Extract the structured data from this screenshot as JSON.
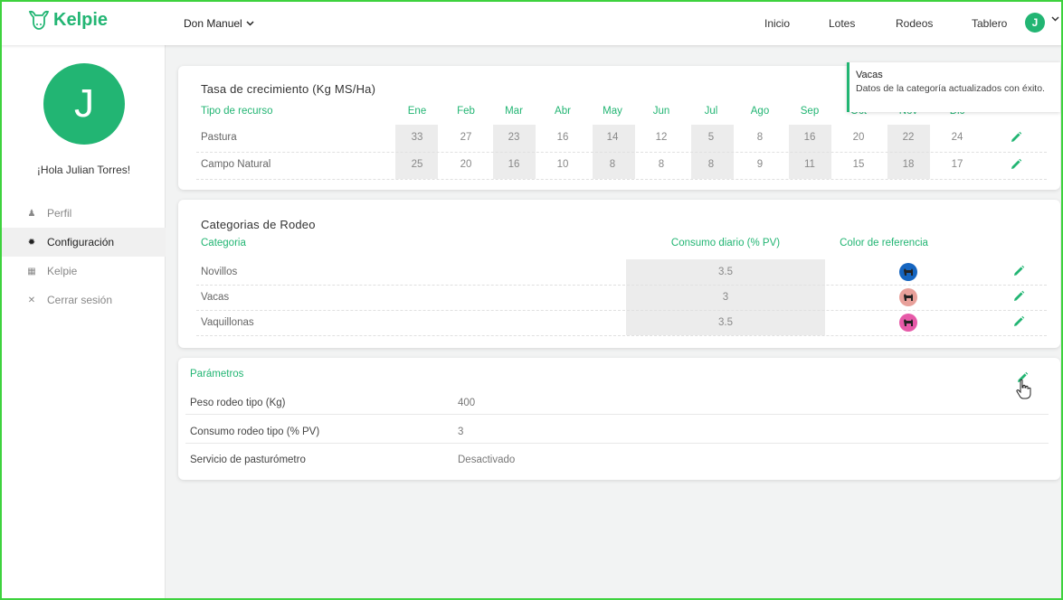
{
  "app": {
    "name": "Kelpie"
  },
  "header": {
    "farm": "Don Manuel",
    "nav": [
      "Inicio",
      "Lotes",
      "Rodeos",
      "Tablero"
    ],
    "user_initial": "J"
  },
  "sidebar": {
    "initial": "J",
    "greeting": "¡Hola Julian Torres!",
    "items": [
      {
        "label": "Perfil",
        "icon": "person-icon"
      },
      {
        "label": "Configuración",
        "icon": "gear-icon"
      },
      {
        "label": "Kelpie",
        "icon": "building-icon"
      },
      {
        "label": "Cerrar sesión",
        "icon": "close-icon"
      }
    ]
  },
  "growth": {
    "title": "Tasa de crecimiento (Kg MS/Ha)",
    "col_resource": "Tipo de recurso",
    "months": [
      "Ene",
      "Feb",
      "Mar",
      "Abr",
      "May",
      "Jun",
      "Jul",
      "Ago",
      "Sep",
      "Oct",
      "Nov",
      "Dic"
    ],
    "rows": [
      {
        "name": "Pastura",
        "values": [
          "33",
          "27",
          "23",
          "16",
          "14",
          "12",
          "5",
          "8",
          "16",
          "20",
          "22",
          "24"
        ]
      },
      {
        "name": "Campo Natural",
        "values": [
          "25",
          "20",
          "16",
          "10",
          "8",
          "8",
          "8",
          "9",
          "11",
          "15",
          "18",
          "17"
        ]
      }
    ]
  },
  "categories": {
    "title": "Categorias de Rodeo",
    "col_category": "Categoria",
    "col_consumption": "Consumo diario (% PV)",
    "col_color": "Color de referencia",
    "rows": [
      {
        "name": "Novillos",
        "consumption": "3.5",
        "color": "#1565c0"
      },
      {
        "name": "Vacas",
        "consumption": "3",
        "color": "#e8a09a"
      },
      {
        "name": "Vaquillonas",
        "consumption": "3.5",
        "color": "#e65aa8"
      }
    ]
  },
  "params": {
    "title": "Parámetros",
    "rows": [
      {
        "label": "Peso rodeo tipo (Kg)",
        "value": "400"
      },
      {
        "label": "Consumo rodeo tipo (% PV)",
        "value": "3"
      },
      {
        "label": "Servicio de pasturómetro",
        "value": "Desactivado"
      }
    ]
  },
  "toast": {
    "title": "Vacas",
    "message": "Datos de la categoría actualizados con éxito."
  },
  "colors": {
    "accent": "#22b573",
    "frame": "#3ed23e"
  }
}
